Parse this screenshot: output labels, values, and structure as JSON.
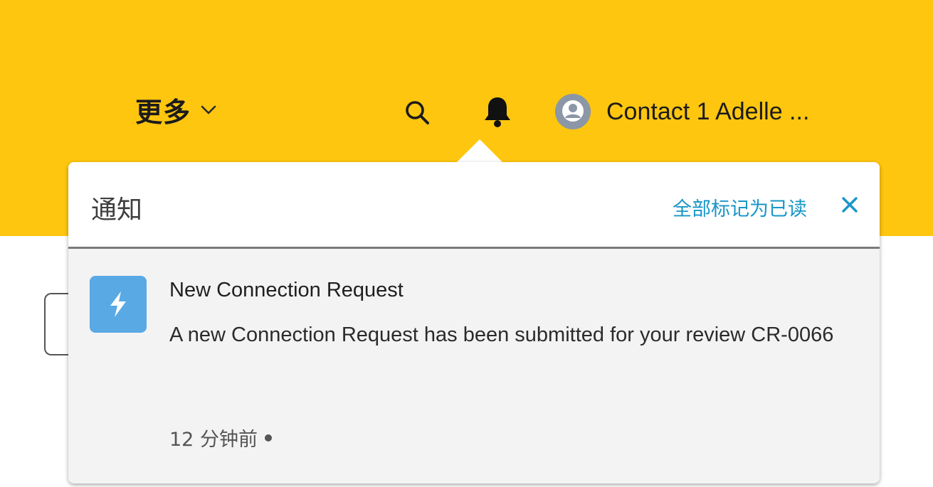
{
  "header": {
    "more_label": "更多",
    "user_name": "Contact 1 Adelle ...",
    "icons": {
      "chevron": "chevron-down-icon",
      "search": "search-icon",
      "bell": "bell-icon",
      "avatar": "user-avatar-icon"
    },
    "background_color": "#FEC60F"
  },
  "notifications_panel": {
    "title": "通知",
    "mark_all_read": "全部标记为已读",
    "close_icon": "close-icon",
    "link_color": "#1796C8",
    "items": [
      {
        "title": "New Connection Request",
        "body": "A new Connection Request has been submitted for your review CR-0066",
        "time": "12 分钟前",
        "icon": "lightning-icon",
        "icon_color": "#59A9E5",
        "unread": true
      }
    ]
  }
}
